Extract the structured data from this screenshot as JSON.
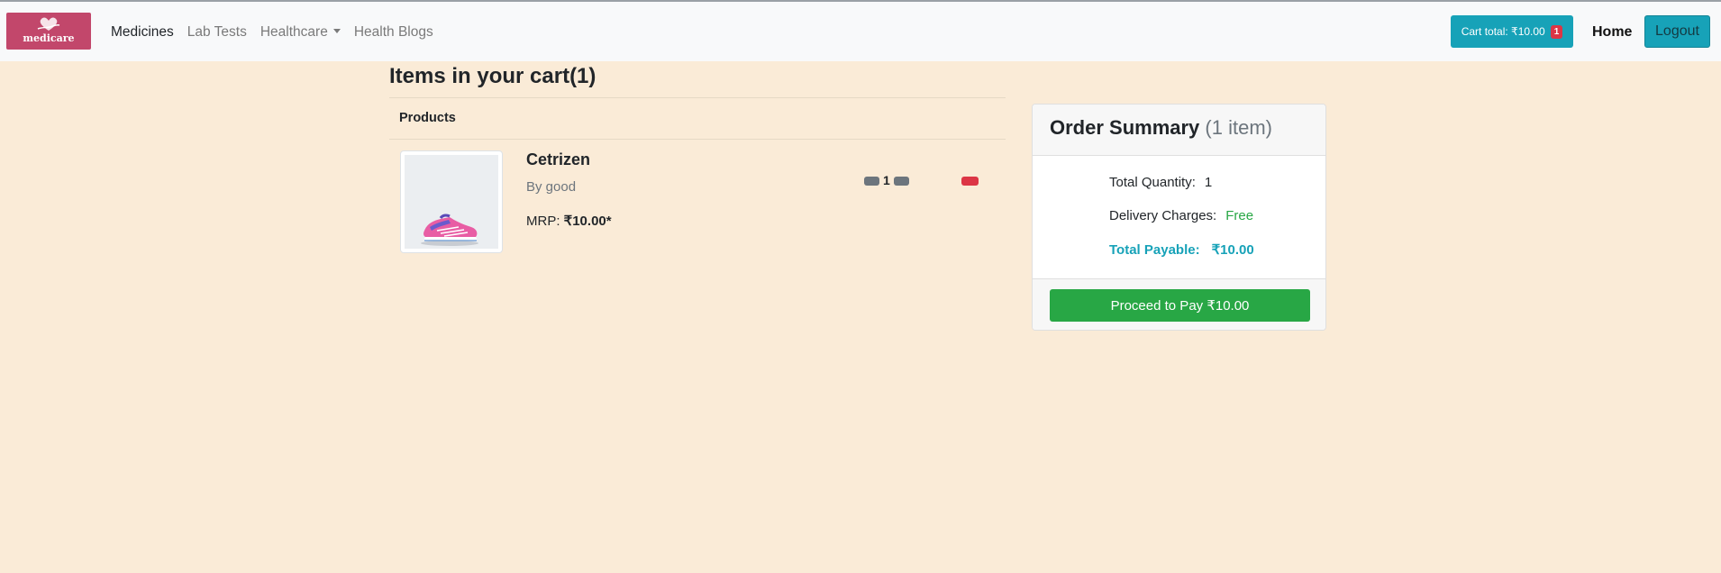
{
  "colors": {
    "page_bg": "#faebd7",
    "navbar_bg": "#f8f9fa",
    "info": "#17a2b8",
    "danger": "#dc3545",
    "success": "#28a745",
    "secondary": "#6c757d",
    "logo_bg": "#c2476b"
  },
  "navbar": {
    "logo_text": "medicare",
    "links": [
      "Medicines",
      "Lab Tests",
      "Healthcare",
      "Health Blogs"
    ],
    "cart_label": "Cart total: ₹10.00",
    "cart_count": "1",
    "home": "Home",
    "logout": "Logout"
  },
  "cart": {
    "title": "Items in your cart(1)",
    "products_header": "Products",
    "item": {
      "name": "Cetrizen",
      "brand": "By good",
      "mrp_label": "MRP: ",
      "price": "₹10.00*",
      "quantity": "1",
      "image": "sneaker-product-image"
    }
  },
  "summary": {
    "title": "Order Summary",
    "count": "(1 item)",
    "qty_label": "Total Quantity:",
    "qty_value": "1",
    "delivery_label": "Delivery Charges:",
    "delivery_value": "Free",
    "payable_label": "Total Payable:",
    "payable_value": "₹10.00",
    "pay_button": "Proceed to Pay ₹10.00"
  }
}
